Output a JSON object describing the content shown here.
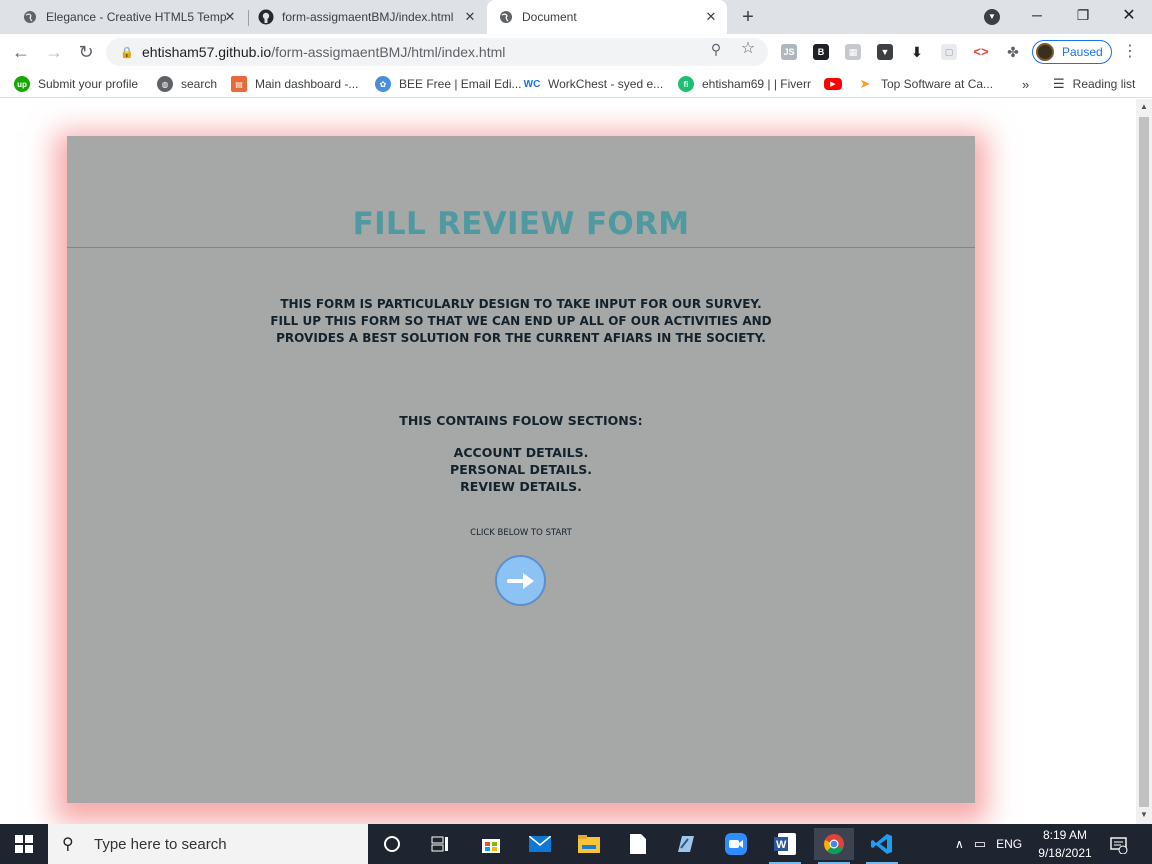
{
  "browser": {
    "tabs": [
      {
        "title": "Elegance - Creative HTML5 Temp",
        "favicon": "globe-icon",
        "active": false
      },
      {
        "title": "form-assigmaentBMJ/index.html",
        "favicon": "github-icon",
        "active": false
      },
      {
        "title": "Document",
        "favicon": "globe-icon",
        "active": true
      }
    ],
    "new_tab_label": "+",
    "url_host": "ehtisham57.github.io",
    "url_path": "/form-assigmaentBMJ/html/index.html",
    "profile_status": "Paused",
    "bookmarks": [
      {
        "label": "Submit your profile",
        "icon": "upwork-icon",
        "color": "#14a800"
      },
      {
        "label": "search",
        "icon": "globe-icon",
        "color": "#5f6368"
      },
      {
        "label": "Main dashboard -...",
        "icon": "dashboard-icon",
        "color": "#e86a3a"
      },
      {
        "label": "BEE Free | Email Edi...",
        "icon": "bee-icon",
        "color": "#4a90d9"
      },
      {
        "label": "WorkChest - syed e...",
        "icon": "workchest-icon",
        "color": "#1f6fd1"
      },
      {
        "label": "ehtisham69 | | Fiverr",
        "icon": "fiverr-icon",
        "color": "#1dbf73"
      },
      {
        "label": "",
        "icon": "youtube-icon",
        "color": "#ff0000"
      },
      {
        "label": "Top Software at Ca...",
        "icon": "capterra-icon",
        "color": "#ff9d28"
      }
    ],
    "more_bookmarks": "»",
    "reading_list": "Reading list"
  },
  "page": {
    "title": "FILL REVIEW FORM",
    "intro_lines": [
      "THIS FORM IS PARTICULARLY DESIGN TO TAKE INPUT FOR OUR SURVEY.",
      "FILL UP THIS FORM SO THAT WE CAN END UP ALL OF OUR ACTIVITIES AND",
      "PROVIDES A BEST SOLUTION FOR THE CURRENT AFIARS IN THE SOCIETY."
    ],
    "sections_heading": "THIS CONTAINS FOLOW SECTIONS:",
    "sections": [
      "ACCOUNT DETAILS.",
      "PERSONAL DETAILS.",
      "REVIEW DETAILS."
    ],
    "start_label": "CLICK BELOW TO START",
    "start_icon": "arrow-right-icon",
    "colors": {
      "card": "#a6a7a7",
      "title": "#4e9aa0",
      "glow": "#f06464",
      "button": "#8cc3f4"
    }
  },
  "taskbar": {
    "search_placeholder": "Type here to search",
    "language": "ENG",
    "time": "8:19 AM",
    "date": "9/18/2021",
    "notifications": "1"
  }
}
